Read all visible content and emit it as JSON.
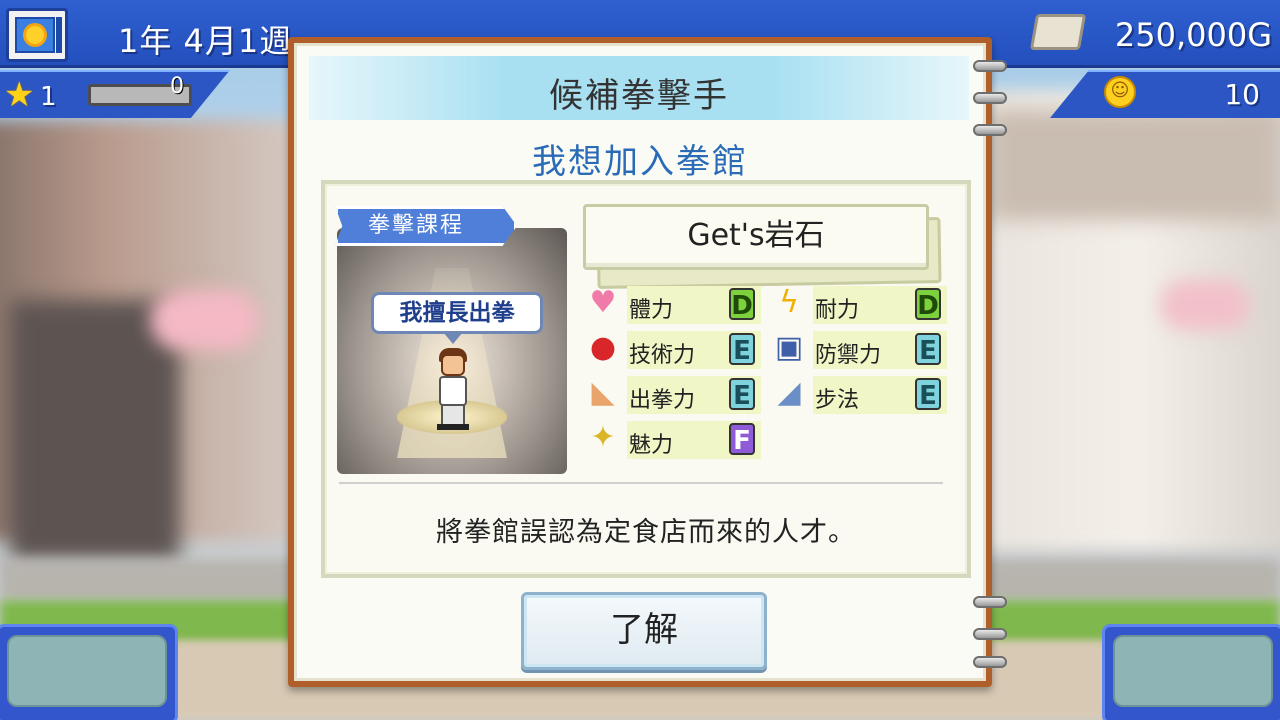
{
  "hud": {
    "date": "1年 4月1週",
    "money": "250,000G",
    "rank": "1",
    "exp_value": "0",
    "exp_progress": 0,
    "fans": "10"
  },
  "dialog": {
    "title": "候補拳擊手",
    "subtitle": "我想加入拳館",
    "course_tag": "拳擊課程",
    "speech": "我擅長出拳",
    "name": "Get's岩石",
    "stats": [
      {
        "label": "體力",
        "grade": "D",
        "icon": "heart-icon",
        "color": "#f07aa8"
      },
      {
        "label": "耐力",
        "grade": "D",
        "icon": "lightning-icon",
        "color": "#f0b000"
      },
      {
        "label": "技術力",
        "grade": "E",
        "icon": "boxing-glove-icon",
        "color": "#d8262b"
      },
      {
        "label": "防禦力",
        "grade": "E",
        "icon": "armor-icon",
        "color": "#3f5fa8"
      },
      {
        "label": "出拳力",
        "grade": "E",
        "icon": "flexed-arm-icon",
        "color": "#e8a46a"
      },
      {
        "label": "步法",
        "grade": "E",
        "icon": "shoe-icon",
        "color": "#6a8ec6"
      },
      {
        "label": "魅力",
        "grade": "F",
        "icon": "sparkle-icon",
        "color": "#d8b628"
      }
    ],
    "description": "將拳館誤認為定食店而來的人才。",
    "ok_label": "了解"
  }
}
